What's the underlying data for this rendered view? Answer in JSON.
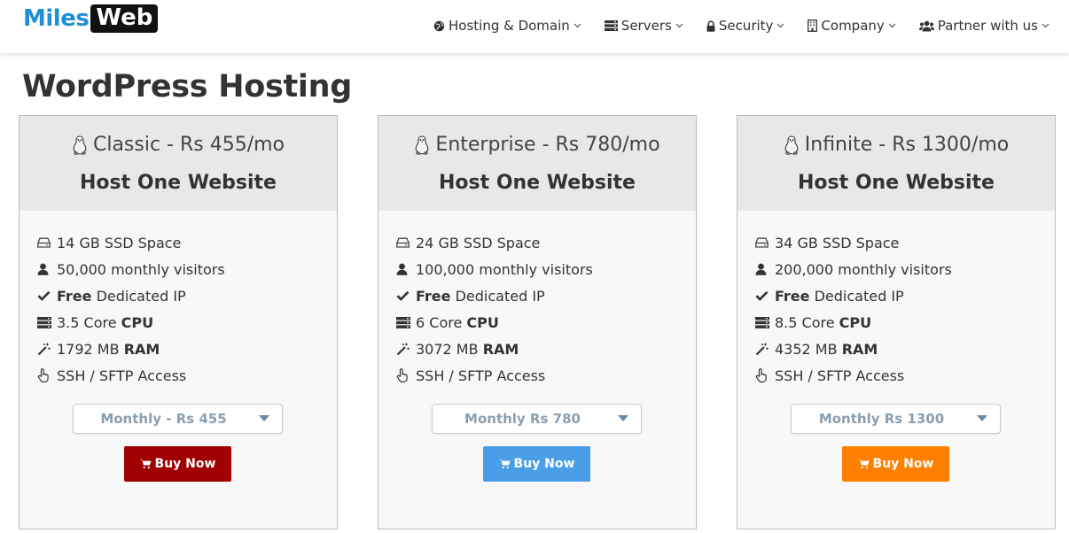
{
  "logo": {
    "part1": "Miles",
    "part2": "Web"
  },
  "nav": [
    {
      "label": "Hosting & Domain",
      "icon": "globe-icon"
    },
    {
      "label": "Servers",
      "icon": "servers-icon"
    },
    {
      "label": "Security",
      "icon": "lock-icon"
    },
    {
      "label": "Company",
      "icon": "building-icon"
    },
    {
      "label": "Partner with us",
      "icon": "users-icon"
    }
  ],
  "page": {
    "title": "WordPress Hosting"
  },
  "plans": [
    {
      "name_line": "Classic - Rs 455/mo",
      "host_line": "Host One Website",
      "storage": "14 GB SSD Space",
      "visitors": "50,000 monthly visitors",
      "ip_bold": "Free",
      "ip_rest": "Dedicated IP",
      "cpu_value": "3.5 Core",
      "cpu_label": "CPU",
      "ram_value": "1792 MB",
      "ram_label": "RAM",
      "access": "SSH / SFTP Access",
      "billing": "Monthly - Rs 455",
      "buy": "Buy Now",
      "button_color": "#a00000"
    },
    {
      "name_line": "Enterprise - Rs 780/mo",
      "host_line": "Host One Website",
      "storage": "24 GB SSD Space",
      "visitors": "100,000 monthly visitors",
      "ip_bold": "Free",
      "ip_rest": "Dedicated IP",
      "cpu_value": "6 Core",
      "cpu_label": "CPU",
      "ram_value": "3072 MB",
      "ram_label": "RAM",
      "access": "SSH / SFTP Access",
      "billing": "Monthly Rs 780",
      "buy": "Buy Now",
      "button_color": "#4a9ee8"
    },
    {
      "name_line": "Infinite - Rs 1300/mo",
      "host_line": "Host One Website",
      "storage": "34 GB SSD Space",
      "visitors": "200,000 monthly visitors",
      "ip_bold": "Free",
      "ip_rest": "Dedicated IP",
      "cpu_value": "8.5 Core",
      "cpu_label": "CPU",
      "ram_value": "4352 MB",
      "ram_label": "RAM",
      "access": "SSH / SFTP Access",
      "billing": "Monthly Rs 1300",
      "buy": "Buy Now",
      "button_color": "#ff8000"
    }
  ],
  "colors": {
    "brand_blue": "#1f8fd6",
    "text": "#333333",
    "select_text": "#8a9fb0"
  }
}
